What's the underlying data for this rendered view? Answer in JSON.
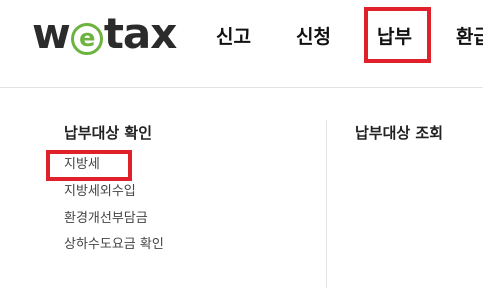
{
  "header": {
    "logo_text_pre": "w",
    "logo_text_e": "e",
    "logo_text_post": "tax",
    "nav": [
      "신고",
      "신청",
      "납부",
      "환급"
    ],
    "active_nav_index": 2
  },
  "mega_menu": {
    "columns": [
      {
        "title": "납부대상 확인",
        "items": [
          "지방세",
          "지방세외수입",
          "환경개선부담금",
          "상하수도요금 확인"
        ]
      },
      {
        "title": "납부대상 조회",
        "items": []
      }
    ]
  },
  "colors": {
    "highlight": "#e0202a",
    "logo_green": "#6cb33f",
    "logo_dark": "#2b2b2b"
  }
}
